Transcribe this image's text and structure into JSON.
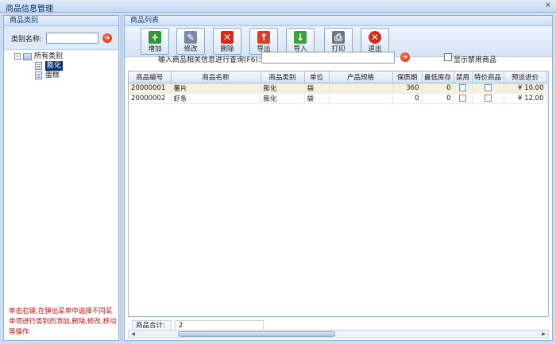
{
  "window": {
    "title": "商品信息管理",
    "close": "×"
  },
  "left": {
    "header": "商品类别",
    "search_label": "类别名称:",
    "search_value": "",
    "tree": {
      "root": "所有类别",
      "children": [
        "膨化",
        "蛋糕"
      ],
      "selected": "膨化"
    },
    "hint": "单击右键,在弹出菜单中选择不同菜单项进行类别的添加,删除,修改,移动等操作"
  },
  "right": {
    "header": "商品列表",
    "toolbar": [
      {
        "label": "增加",
        "icon": "add-icon",
        "color": "#2f9a35"
      },
      {
        "label": "修改",
        "icon": "edit-icon",
        "color": "#7a8aa3"
      },
      {
        "label": "删除",
        "icon": "delete-icon",
        "color": "#d42a1a"
      },
      {
        "label": "导出",
        "icon": "export-icon",
        "color": "#d8402a"
      },
      {
        "label": "导入",
        "icon": "import-icon",
        "color": "#3aa33a"
      },
      {
        "label": "打印",
        "icon": "print-icon",
        "color": "#6c7785"
      },
      {
        "label": "退出",
        "icon": "exit-icon",
        "color": "#d42a1a"
      }
    ],
    "search_label": "输入商品相关信息进行查询(F6)：",
    "search_value": "",
    "show_disabled_label": "显示禁用商品",
    "columns": [
      "商品编号",
      "商品名称",
      "商品类别",
      "单位",
      "产品规格",
      "保质期",
      "最低库存",
      "禁用",
      "特价商品",
      "预设进价"
    ],
    "rows": [
      {
        "code": "20000001",
        "name": "薯片",
        "category": "膨化",
        "unit": "袋",
        "spec": "",
        "shelf": "360",
        "minstock": "0",
        "price": "¥ 10.00"
      },
      {
        "code": "20000002",
        "name": "虾条",
        "category": "膨化",
        "unit": "袋",
        "spec": "",
        "shelf": "0",
        "minstock": "0",
        "price": "¥ 12.00"
      }
    ],
    "total_label": "商品合计:",
    "total_value": "2"
  }
}
